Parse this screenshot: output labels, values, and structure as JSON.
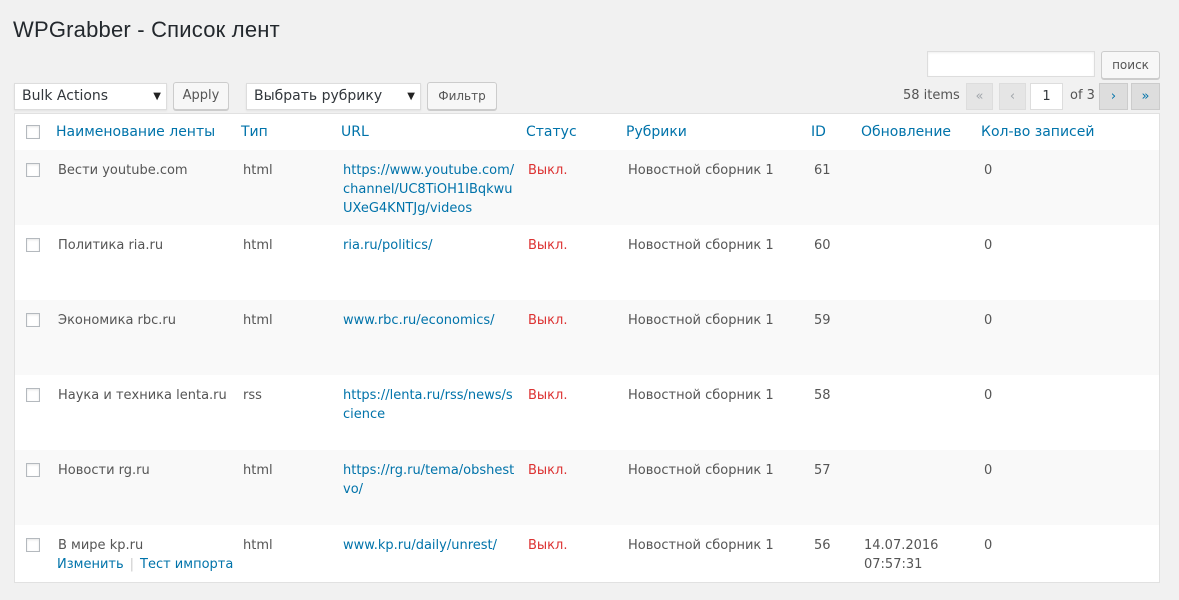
{
  "page_title": "WPGrabber - Список лент",
  "search": {
    "value": "",
    "button_label": "поиск"
  },
  "toolbar": {
    "bulk_actions": "Bulk Actions",
    "apply_label": "Apply",
    "category_select": "Выбрать рубрику",
    "filter_label": "Фильтр"
  },
  "pagination": {
    "items_count": "58 items",
    "first": "«",
    "prev": "‹",
    "current_page": "1",
    "of_pages": "of 3",
    "next": "›",
    "last": "»"
  },
  "columns": {
    "name": "Наименование ленты",
    "type": "Тип",
    "url": "URL",
    "status": "Статус",
    "category": "Рубрики",
    "id": "ID",
    "updated": "Обновление",
    "count": "Кол-во записей"
  },
  "rows": [
    {
      "name": "Вести youtube.com",
      "type": "html",
      "url": "https://www.youtube.com/channel/UC8TiOH1IBqkwuUXeG4KNTJg/videos",
      "url_lines": [
        "https://www.youtube.com/",
        "channel/UC8TiOH1IBqkwu",
        "UXeG4KNTJg/videos"
      ],
      "status": "Выкл.",
      "category": "Новостной сборник 1",
      "id": "61",
      "updated": "",
      "count": "0"
    },
    {
      "name": "Политика ria.ru",
      "type": "html",
      "url": "ria.ru/politics/",
      "url_lines": [
        "ria.ru/politics/"
      ],
      "status": "Выкл.",
      "category": "Новостной сборник 1",
      "id": "60",
      "updated": "",
      "count": "0"
    },
    {
      "name": "Экономика rbc.ru",
      "type": "html",
      "url": "www.rbc.ru/economics/",
      "url_lines": [
        "www.rbc.ru/economics/"
      ],
      "status": "Выкл.",
      "category": "Новостной сборник 1",
      "id": "59",
      "updated": "",
      "count": "0"
    },
    {
      "name": "Наука и техника lenta.ru",
      "type": "rss",
      "url": "https://lenta.ru/rss/news/science",
      "url_lines": [
        "https://lenta.ru/rss/news/s",
        "cience"
      ],
      "status": "Выкл.",
      "category": "Новостной сборник 1",
      "id": "58",
      "updated": "",
      "count": "0"
    },
    {
      "name": "Новости rg.ru",
      "type": "html",
      "url": "https://rg.ru/tema/obshestvo/",
      "url_lines": [
        "https://rg.ru/tema/obshest",
        "vo/"
      ],
      "status": "Выкл.",
      "category": "Новостной сборник 1",
      "id": "57",
      "updated": "",
      "count": "0"
    },
    {
      "name": "В мире kp.ru",
      "type": "html",
      "url": "www.kp.ru/daily/unrest/",
      "url_lines": [
        "www.kp.ru/daily/unrest/"
      ],
      "status": "Выкл.",
      "category": "Новостной сборник 1",
      "id": "56",
      "updated": "14.07.2016 07:57:31",
      "updated_lines": [
        "14.07.2016",
        "07:57:31"
      ],
      "count": "0",
      "row_actions": {
        "edit": "Изменить",
        "test_import": "Тест импорта"
      }
    }
  ]
}
